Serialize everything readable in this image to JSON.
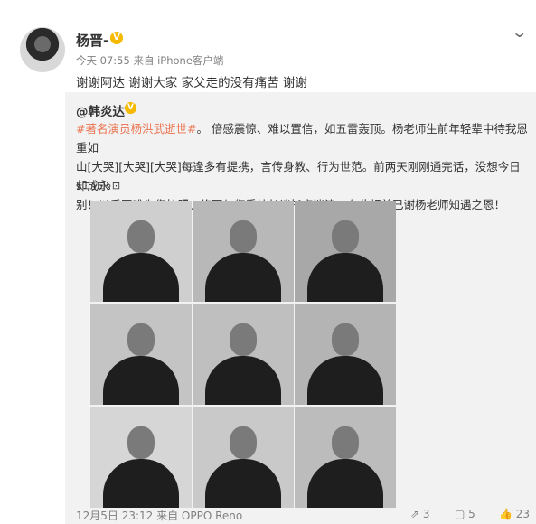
{
  "post": {
    "username": "杨晋-",
    "verified": "V",
    "meta": "今天 07:55 来自 iPhone客户端",
    "text": "谢谢阿达  谢谢大家  家父走的没有痛苦  谢谢"
  },
  "repost": {
    "author": "@韩炎达",
    "verified": "V",
    "hashtag": "#著名演员杨洪武逝世#",
    "body_line1_rest": "。 倍感震惊、难以置信，如五雷轰顶。杨老师生前年轻辈中待我恩重如",
    "body_line2": "山[大哭][大哭][大哭]每逢多有提携，言传身教、行为世范。前两天刚刚通完话，没想今日却成永",
    "body_line3": "别！以后再难为您拍照、修图与您秉烛长谈指点迷津。在此顿首已谢杨老师知遇之恩！",
    "extra": "§⊡§⊡§⊡",
    "photos": [
      {
        "label": "photo-1"
      },
      {
        "label": "photo-2"
      },
      {
        "label": "photo-3"
      },
      {
        "label": "photo-4"
      },
      {
        "label": "photo-5"
      },
      {
        "label": "photo-6"
      },
      {
        "label": "photo-7"
      },
      {
        "label": "photo-8"
      },
      {
        "label": "photo-9"
      }
    ],
    "footer": "12月5日 23:12 来自 OPPO Reno",
    "actions": {
      "forward_count": "3",
      "comment_count": "5",
      "like_count": "23"
    }
  },
  "icons": {
    "chevron": "chevron-down-icon",
    "forward": "forward-icon",
    "comment": "comment-icon",
    "like": "like-icon"
  }
}
